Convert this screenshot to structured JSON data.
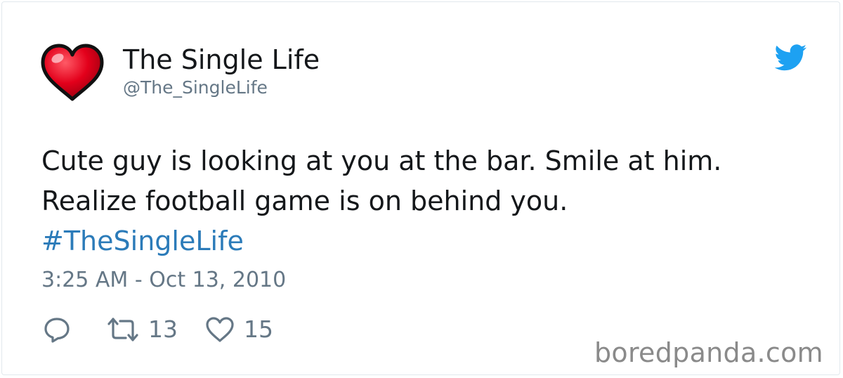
{
  "author": {
    "display_name": "The Single Life",
    "handle": "@The_SingleLife",
    "avatar_icon": "red-heart-icon"
  },
  "brand": {
    "icon": "twitter-bird-icon",
    "color": "#1da1f2"
  },
  "tweet": {
    "lines": [
      "Cute guy is looking at you at the bar. Smile at him.",
      "Realize football game is on behind you."
    ],
    "hashtag": "#TheSingleLife",
    "hashtag_color": "#2b7bb9",
    "timestamp": "3:25 AM - Oct 13, 2010"
  },
  "actions": {
    "reply_icon": "reply-icon",
    "retweet_icon": "retweet-icon",
    "retweet_count": "13",
    "like_icon": "heart-outline-icon",
    "like_count": "15"
  },
  "watermark": "boredpanda.com"
}
